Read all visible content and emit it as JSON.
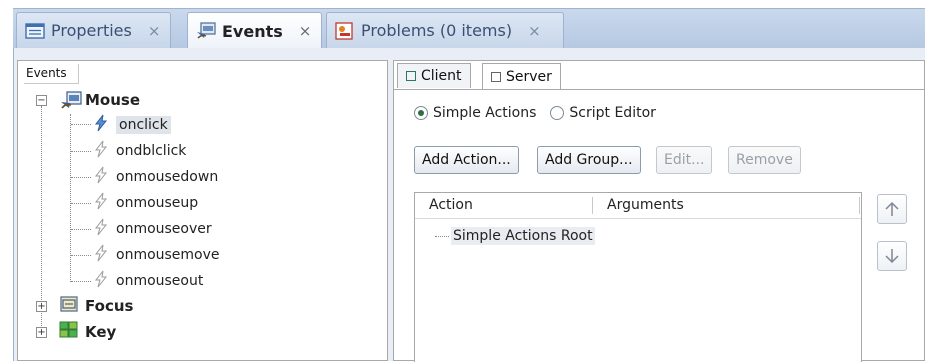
{
  "tabs": [
    {
      "label": "Properties",
      "icon": "properties-icon",
      "active": false
    },
    {
      "label": "Events",
      "icon": "events-icon",
      "active": true
    },
    {
      "label": "Problems (0 items)",
      "icon": "problems-icon",
      "active": false
    }
  ],
  "close_glyph": "×",
  "events_panel": {
    "header": "Events",
    "categories": [
      {
        "label": "Mouse",
        "icon": "mouse-icon",
        "expanded": true,
        "events": [
          {
            "label": "onclick",
            "selected": true
          },
          {
            "label": "ondblclick",
            "selected": false
          },
          {
            "label": "onmousedown",
            "selected": false
          },
          {
            "label": "onmouseup",
            "selected": false
          },
          {
            "label": "onmouseover",
            "selected": false
          },
          {
            "label": "onmousemove",
            "selected": false
          },
          {
            "label": "onmouseout",
            "selected": false
          }
        ]
      },
      {
        "label": "Focus",
        "icon": "focus-icon",
        "expanded": false
      },
      {
        "label": "Key",
        "icon": "key-icon",
        "expanded": false
      }
    ]
  },
  "side_tabs": [
    {
      "label": "Client",
      "active": false
    },
    {
      "label": "Server",
      "active": true
    }
  ],
  "radios": [
    {
      "label": "Simple Actions",
      "checked": true
    },
    {
      "label": "Script Editor",
      "checked": false
    }
  ],
  "buttons": [
    {
      "label": "Add Action...",
      "enabled": true
    },
    {
      "label": "Add Group...",
      "enabled": true
    },
    {
      "label": "Edit...",
      "enabled": false
    },
    {
      "label": "Remove",
      "enabled": false
    }
  ],
  "actions_table": {
    "columns": [
      "Action",
      "Arguments"
    ],
    "root_label": "Simple Actions Root"
  },
  "colors": {
    "tab_strip": "#b6c9e2",
    "content_bg": "#e9eef6",
    "selection": "#dfe3ea"
  }
}
